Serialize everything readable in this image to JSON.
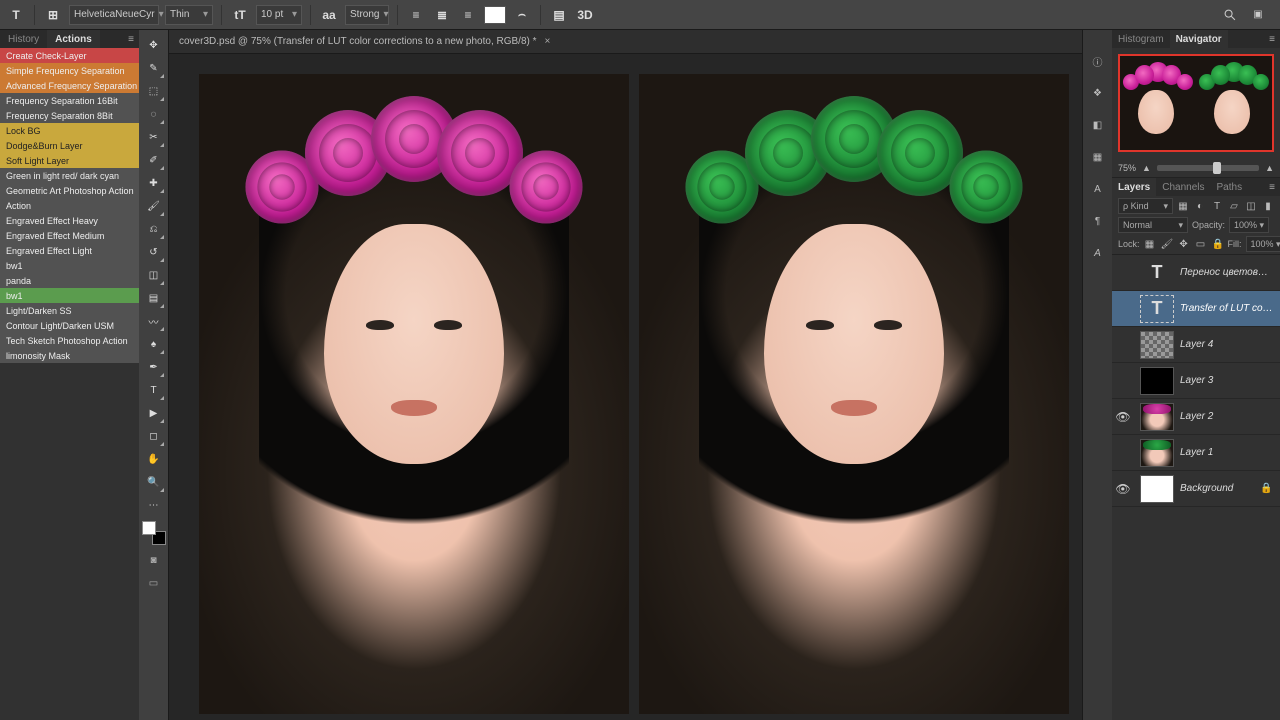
{
  "options_bar": {
    "tool_letter": "T",
    "font_family": "HelveticaNeueCyr",
    "font_weight": "Thin",
    "font_size_icon": "tT",
    "font_size": "10 pt",
    "aa_label": "aa",
    "antialiasing": "Strong",
    "warp_label": "⌢",
    "three_d_label": "3D"
  },
  "doc_tab": {
    "title": "cover3D.psd @ 75% (Transfer of LUT color corrections to a new photo, RGB/8) *"
  },
  "actions_panel": {
    "tabs": {
      "history": "History",
      "actions": "Actions"
    },
    "items": [
      {
        "label": "Create Check-Layer",
        "cls": "ai-red"
      },
      {
        "label": "Simple Frequency Separation",
        "cls": "ai-orange"
      },
      {
        "label": "Advanced Frequency Separation",
        "cls": "ai-orange"
      },
      {
        "label": "Frequency Separation 16Bit",
        "cls": "ai-gray"
      },
      {
        "label": "Frequency Separation 8Bit",
        "cls": "ai-gray"
      },
      {
        "label": "Lock BG",
        "cls": "ai-yellow"
      },
      {
        "label": "Dodge&Burn Layer",
        "cls": "ai-yellow"
      },
      {
        "label": "Soft Light Layer",
        "cls": "ai-yellow"
      },
      {
        "label": "Green in light red/ dark cyan",
        "cls": "ai-gray"
      },
      {
        "label": "Geometric Art Photoshop Action",
        "cls": "ai-gray"
      },
      {
        "label": "Action",
        "cls": "ai-gray"
      },
      {
        "label": "Engraved Effect Heavy",
        "cls": "ai-gray"
      },
      {
        "label": "Engraved Effect Medium",
        "cls": "ai-gray"
      },
      {
        "label": "Engraved Effect Light",
        "cls": "ai-gray"
      },
      {
        "label": "bw1",
        "cls": "ai-gray"
      },
      {
        "label": "panda",
        "cls": "ai-gray"
      },
      {
        "label": "bw1",
        "cls": "ai-green"
      },
      {
        "label": "Light/Darken SS",
        "cls": "ai-gray"
      },
      {
        "label": "Contour Light/Darken USM",
        "cls": "ai-gray"
      },
      {
        "label": "Tech Sketch Photoshop Action",
        "cls": "ai-gray"
      },
      {
        "label": "limonosity Mask",
        "cls": "ai-gray"
      }
    ]
  },
  "navigator": {
    "tabs": {
      "histogram": "Histogram",
      "navigator": "Navigator"
    },
    "zoom": "75%"
  },
  "layers_panel": {
    "tabs": {
      "layers": "Layers",
      "channels": "Channels",
      "paths": "Paths"
    },
    "kind_label": "ρ Kind",
    "blend_mode": "Normal",
    "opacity_label": "Opacity:",
    "opacity_value": "100%",
    "lock_label": "Lock:",
    "fill_label": "Fill:",
    "fill_value": "100%",
    "layers": [
      {
        "name": "Перенос цветовых к...",
        "thumb": "text",
        "visible": false,
        "selected": false
      },
      {
        "name": "Transfer of LUT color ...",
        "thumb": "text-sel",
        "visible": false,
        "selected": true
      },
      {
        "name": "Layer 4",
        "thumb": "trans",
        "visible": false,
        "selected": false
      },
      {
        "name": "Layer 3",
        "thumb": "black",
        "visible": false,
        "selected": false
      },
      {
        "name": "Layer 2",
        "thumb": "pink-img",
        "visible": true,
        "selected": false
      },
      {
        "name": "Layer 1",
        "thumb": "green-img",
        "visible": false,
        "selected": false
      },
      {
        "name": "Background",
        "thumb": "white",
        "visible": true,
        "selected": false,
        "locked": true
      }
    ]
  }
}
